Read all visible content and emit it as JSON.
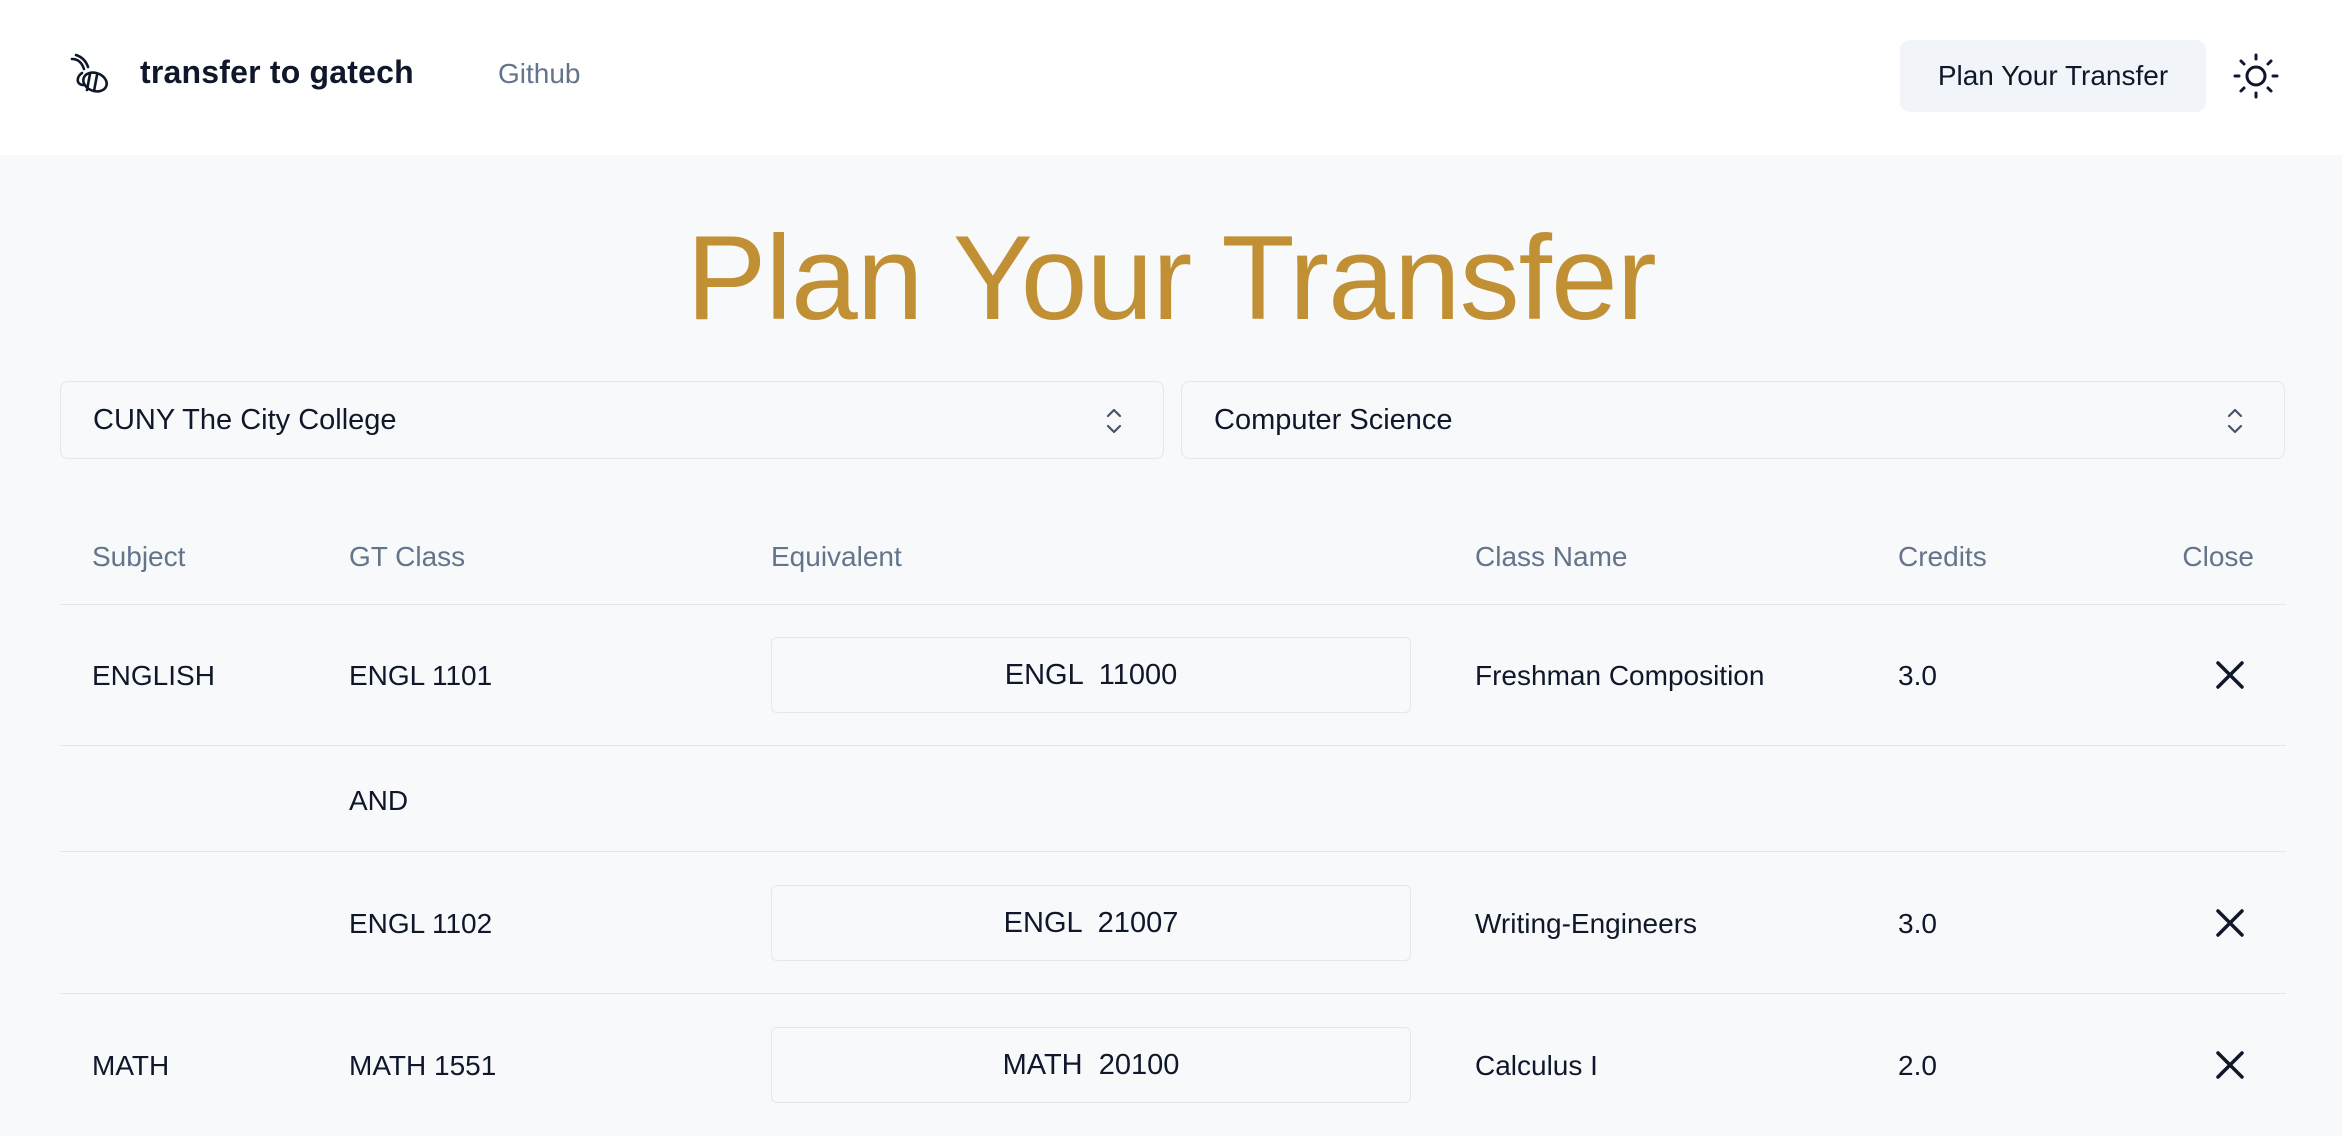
{
  "header": {
    "brand": "transfer to gatech",
    "nav_github": "Github",
    "plan_button": "Plan Your Transfer",
    "logo_icon": "bee-icon",
    "theme_icon": "sun-icon"
  },
  "page": {
    "title": "Plan Your Transfer"
  },
  "filters": {
    "school": "CUNY The City College",
    "major": "Computer Science"
  },
  "table": {
    "headers": [
      "Subject",
      "GT Class",
      "Equivalent",
      "Class Name",
      "Credits",
      "Close"
    ],
    "rows": [
      {
        "subject": "ENGLISH",
        "gt_class": "ENGL 1101",
        "equivalent": "ENGL  11000",
        "class_name": "Freshman Composition",
        "credits": "3.0"
      },
      {
        "connector": "AND"
      },
      {
        "subject": "",
        "gt_class": "ENGL 1102",
        "equivalent": "ENGL  21007",
        "class_name": "Writing-Engineers",
        "credits": "3.0"
      },
      {
        "subject": "MATH",
        "gt_class": "MATH 1551",
        "equivalent": "MATH  20100",
        "class_name": "Calculus I",
        "credits": "2.0"
      }
    ]
  },
  "colors": {
    "title": "#c29034",
    "header_bg": "#ffffff",
    "page_bg": "#f8f9fa",
    "button_bg": "#f1f5f9"
  }
}
